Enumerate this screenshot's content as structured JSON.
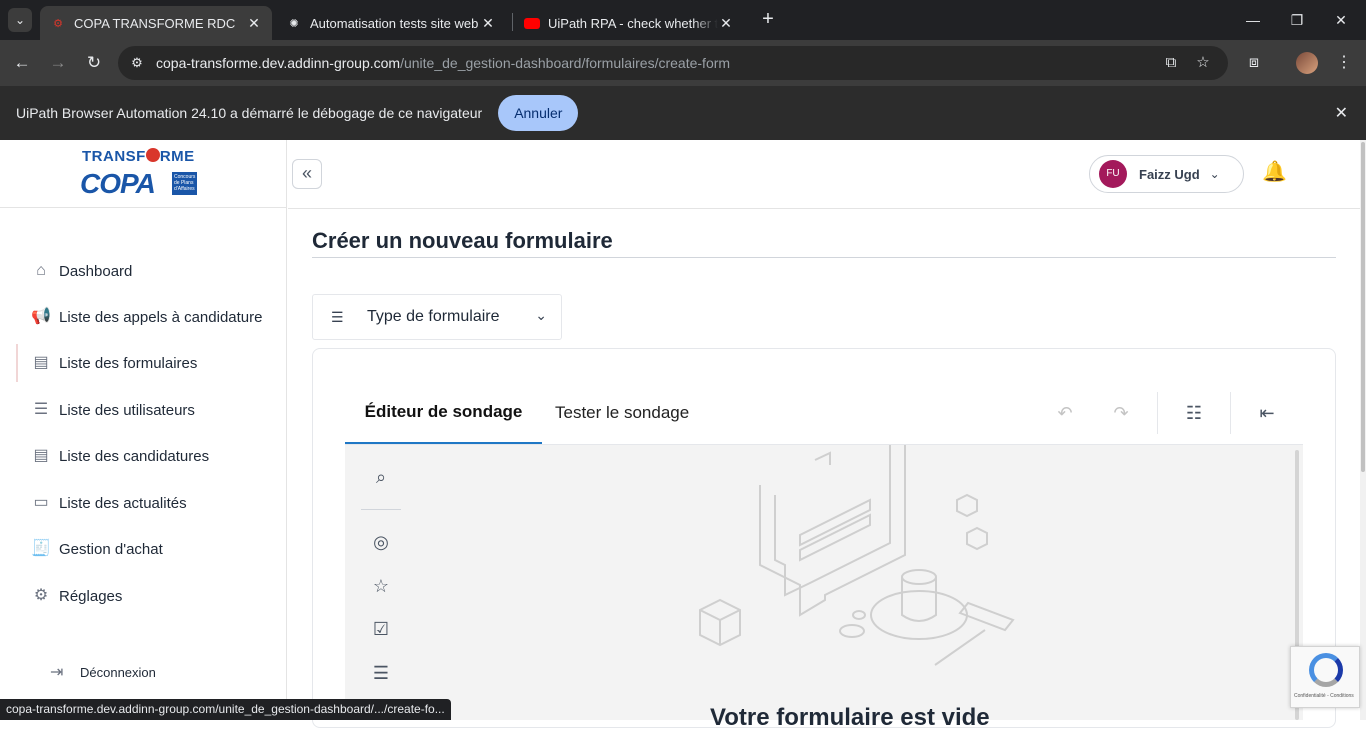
{
  "browser": {
    "tabs": [
      {
        "title": "COPA TRANSFORME RDC",
        "active": true
      },
      {
        "title": "Automatisation tests site web",
        "active": false
      },
      {
        "title": "UiPath RPA - check whether the",
        "active": false
      }
    ],
    "url_host": "copa-transforme.dev.addinn-group.com",
    "url_path": "/unite_de_gestion-dashboard/formulaires/create-form",
    "infobar": {
      "text": "UiPath Browser Automation 24.10 a démarré le débogage de ce navigateur",
      "button": "Annuler"
    },
    "status_url": "copa-transforme.dev.addinn-group.com/unite_de_gestion-dashboard/.../create-fo..."
  },
  "logo": {
    "line1": "TRANSF",
    "line1b": "RME",
    "line2": "COPA",
    "box": "Concours de Plans d'Affaires"
  },
  "sidebar": {
    "items": [
      {
        "label": "Dashboard",
        "icon": "home-icon"
      },
      {
        "label": "Liste des appels à candidature",
        "icon": "megaphone-icon"
      },
      {
        "label": "Liste des formulaires",
        "icon": "document-icon"
      },
      {
        "label": "Liste des utilisateurs",
        "icon": "users-list-icon"
      },
      {
        "label": "Liste des candidatures",
        "icon": "document-icon"
      },
      {
        "label": "Liste des actualités",
        "icon": "news-icon"
      },
      {
        "label": "Gestion d'achat",
        "icon": "receipt-icon"
      },
      {
        "label": "Réglages",
        "icon": "gear-icon"
      }
    ],
    "logout": "Déconnexion"
  },
  "header": {
    "user_initials": "FU",
    "user_name": "Faizz Ugd"
  },
  "main": {
    "title": "Créer un nouveau formulaire",
    "type_select_label": "Type de formulaire",
    "tabs": [
      "Éditeur de sondage",
      "Tester le sondage"
    ],
    "empty_title": "Votre formulaire est vide"
  },
  "recaptcha": {
    "text": "Confidentialité - Conditions"
  },
  "colors": {
    "accent": "#1f77c5",
    "avatar": "#a3195b",
    "brand": "#1a56a8"
  }
}
